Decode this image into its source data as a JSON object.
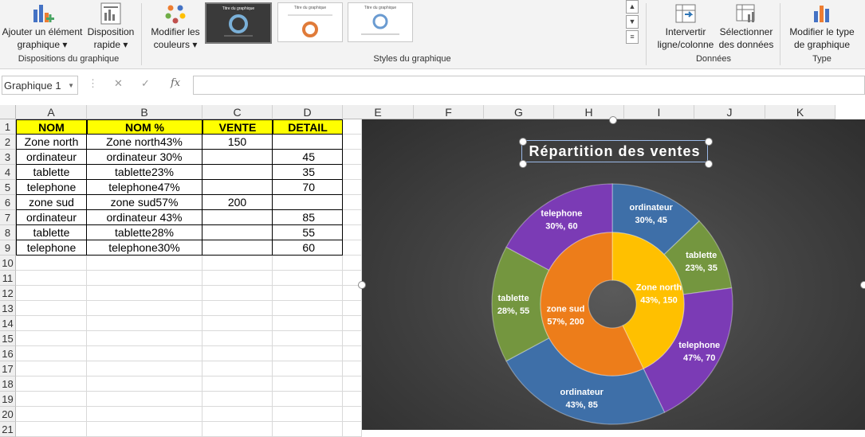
{
  "ribbon": {
    "add_element": [
      "Ajouter un élément",
      "graphique ▾"
    ],
    "quick_layout": [
      "Disposition",
      "rapide ▾"
    ],
    "change_colors": [
      "Modifier les",
      "couleurs ▾"
    ],
    "switch_row_col": [
      "Intervertir",
      "ligne/colonne"
    ],
    "select_data": [
      "Sélectionner",
      "des données"
    ],
    "change_type": [
      "Modifier le type",
      "de graphique"
    ],
    "groups": {
      "layouts": "Dispositions du graphique",
      "styles": "Styles du graphique",
      "data": "Données",
      "type": "Type"
    },
    "style_thumbs": [
      "Titre du graphique",
      "Titre du graphique",
      "Titre du graphique"
    ]
  },
  "formula_bar": {
    "name_box": "Graphique 1",
    "fx": "fx",
    "cancel": "✕",
    "confirm": "✓"
  },
  "columns": [
    "A",
    "B",
    "C",
    "D",
    "E",
    "F",
    "G",
    "H",
    "I",
    "J",
    "K"
  ],
  "rows": [
    "1",
    "2",
    "3",
    "4",
    "5",
    "6",
    "7",
    "8",
    "9",
    "10",
    "11",
    "12",
    "13",
    "14",
    "15",
    "16",
    "17",
    "18",
    "19",
    "20",
    "21"
  ],
  "sheet": {
    "headers": [
      "NOM",
      "NOM %",
      "VENTE",
      "DETAIL"
    ],
    "data": [
      [
        "Zone north",
        "Zone north43%",
        "150",
        ""
      ],
      [
        "ordinateur",
        "ordinateur 30%",
        "",
        "45"
      ],
      [
        "tablette",
        "tablette23%",
        "",
        "35"
      ],
      [
        "telephone",
        "telephone47%",
        "",
        "70"
      ],
      [
        "zone sud",
        "zone sud57%",
        "200",
        ""
      ],
      [
        "ordinateur",
        "ordinateur 43%",
        "",
        "85"
      ],
      [
        "tablette",
        "tablette28%",
        "",
        "55"
      ],
      [
        "telephone",
        "telephone30%",
        "",
        "60"
      ]
    ]
  },
  "chart_data": {
    "type": "doughnut",
    "title": "Répartition des ventes",
    "inner_ring": [
      {
        "name": "Zone north",
        "label": "Zone north",
        "detail": "43%, 150",
        "value": 150,
        "color": "#FFC000"
      },
      {
        "name": "zone sud",
        "label": "zone sud",
        "detail": "57%, 200",
        "value": 200,
        "color": "#ED7D1A"
      }
    ],
    "outer_ring": [
      {
        "name": "ordinateur",
        "label": "ordinateur",
        "detail": "30%, 45",
        "value": 45,
        "color": "#3E6FA8"
      },
      {
        "name": "tablette",
        "label": "tablette",
        "detail": "23%, 35",
        "value": 35,
        "color": "#74963F"
      },
      {
        "name": "telephone",
        "label": "telephone",
        "detail": "47%, 70",
        "value": 70,
        "color": "#7B3BB5"
      },
      {
        "name": "ordinateur",
        "label": "ordinateur",
        "detail": "43%, 85",
        "value": 85,
        "color": "#3E6FA8"
      },
      {
        "name": "tablette",
        "label": "tablette",
        "detail": "28%, 55",
        "value": 55,
        "color": "#74963F"
      },
      {
        "name": "telephone",
        "label": "telephone",
        "detail": "30%, 60",
        "value": 60,
        "color": "#7B3BB5"
      }
    ]
  }
}
